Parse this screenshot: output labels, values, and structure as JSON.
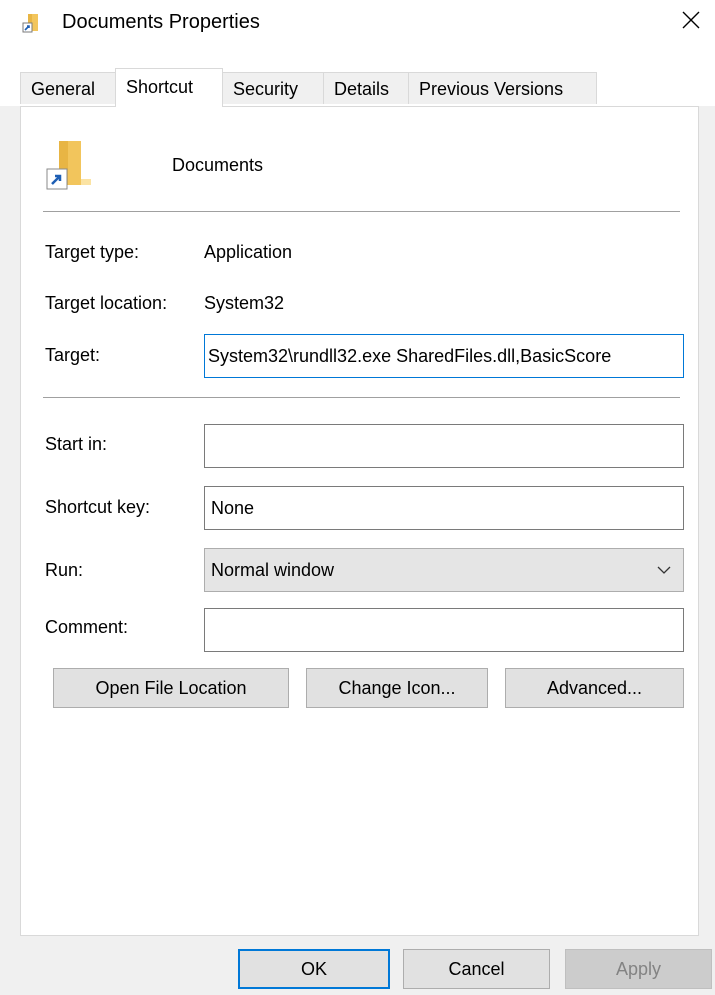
{
  "window": {
    "title": "Documents Properties",
    "close_glyph": "✕",
    "accent_color": "#0078d7"
  },
  "tabs": [
    {
      "label": "General",
      "active": false
    },
    {
      "label": "Shortcut",
      "active": true
    },
    {
      "label": "Security",
      "active": false
    },
    {
      "label": "Details",
      "active": false
    },
    {
      "label": "Previous Versions",
      "active": false
    }
  ],
  "shortcut": {
    "name": "Documents",
    "icon": "folder-shortcut-icon",
    "target_type_label": "Target type:",
    "target_type_value": "Application",
    "target_location_label": "Target location:",
    "target_location_value": "System32",
    "target_label": "Target:",
    "target_value": "System32\\rundll32.exe SharedFiles.dll,BasicScore",
    "start_in_label": "Start in:",
    "start_in_value": "",
    "shortcut_key_label": "Shortcut key:",
    "shortcut_key_value": "None",
    "run_label": "Run:",
    "run_value": "Normal window",
    "comment_label": "Comment:",
    "comment_value": ""
  },
  "panel_buttons": {
    "open_file_location": "Open File Location",
    "change_icon": "Change Icon...",
    "advanced": "Advanced..."
  },
  "dialog_buttons": {
    "ok": "OK",
    "cancel": "Cancel",
    "apply": "Apply"
  }
}
